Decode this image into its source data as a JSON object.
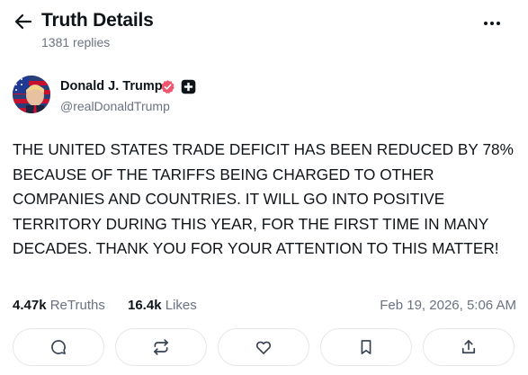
{
  "header": {
    "title": "Truth Details",
    "subtitle": "1381 replies"
  },
  "author": {
    "name": "Donald J. Trump",
    "handle": "@realDonaldTrump"
  },
  "post": {
    "text": "THE UNITED STATES TRADE DEFICIT HAS BEEN REDUCED BY 78% BECAUSE OF THE TARIFFS BEING CHARGED TO OTHER COMPANIES AND COUNTRIES. IT WILL GO INTO POSITIVE TERRITORY DURING THIS YEAR, FOR THE FIRST TIME IN MANY DECADES. THANK YOU FOR YOUR ATTENTION TO THIS MATTER!"
  },
  "stats": {
    "retruths_count": "4.47k",
    "retruths_label": "ReTruths",
    "likes_count": "16.4k",
    "likes_label": "Likes",
    "timestamp": "Feb 19, 2026, 5:06 AM"
  },
  "icons": {
    "back": "arrow-left-icon",
    "more": "more-horizontal-icon",
    "verified": "verified-badge-icon",
    "plus": "plus-badge-icon",
    "reply": "reply-icon",
    "retruth": "retruth-icon",
    "like": "heart-icon",
    "bookmark": "bookmark-icon",
    "share": "share-icon"
  },
  "colors": {
    "verified_badge": "#f0576e",
    "text": "#0f1419",
    "muted": "#6b7280"
  }
}
